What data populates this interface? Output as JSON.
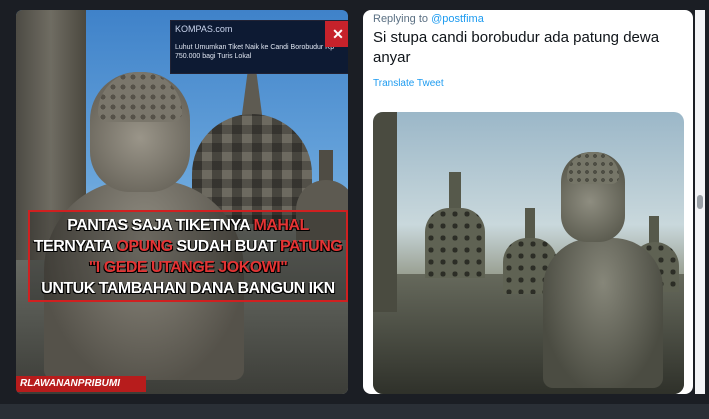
{
  "left_meme": {
    "news_thumbnail": {
      "site": "KOMPAS.com",
      "headline": "Luhut Umumkan Tiket Naik ke Candi Borobudur Rp 750.000 bagi Turis Lokal"
    },
    "caption": {
      "line1_prefix": "PANTAS SAJA TIKETNYA ",
      "line1_highlight": "MAHAL",
      "line2_prefix": "TERNYATA ",
      "line2_highlight1": "OPUNG",
      "line2_middle": " SUDAH BUAT ",
      "line2_highlight2": "PATUNG",
      "line3_highlight": "\"I GEDE UTANGE JOKOWI\"",
      "line4": "UNTUK TAMBAHAN DANA BANGUN IKN"
    },
    "watermark": "RLAWANANPRIBUMI",
    "colors": {
      "highlight": "#e43434",
      "border": "#d02020"
    }
  },
  "tweet": {
    "replying_label": "Replying to ",
    "replying_handle": "@postfima",
    "text": "Si stupa candi borobudur ada patung dewa anyar",
    "translate_label": "Translate Tweet",
    "link_color": "#1d9bf0"
  }
}
